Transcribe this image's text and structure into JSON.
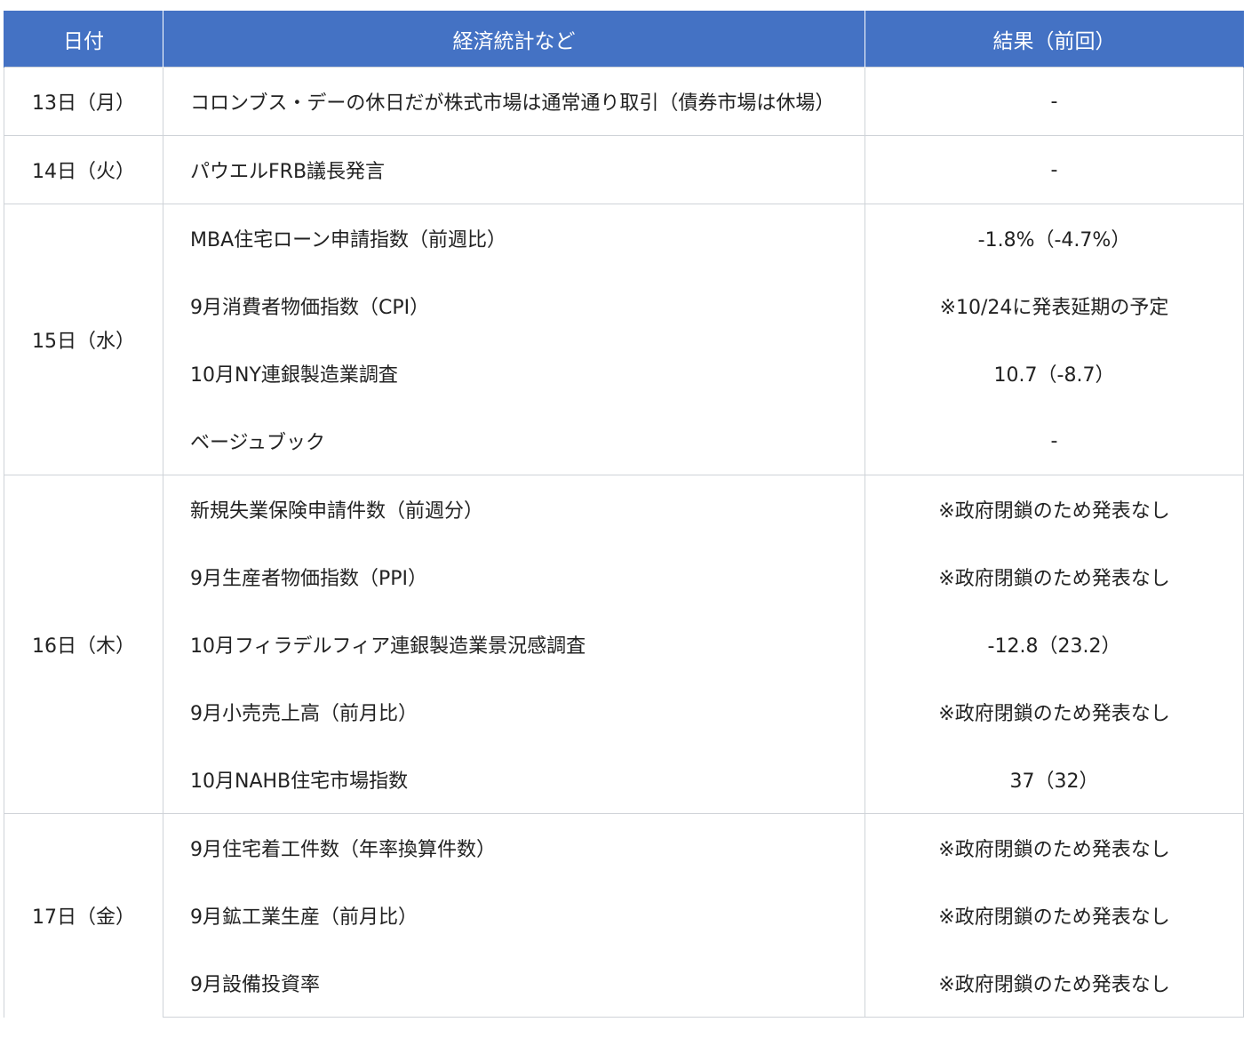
{
  "header": {
    "date": "日付",
    "event": "経済統計など",
    "result": "結果（前回）"
  },
  "rows": [
    {
      "date": "13日（月）",
      "event": "コロンブス・デーの休日だが株式市場は通常通り取引（債券市場は休場）",
      "result": "-"
    },
    {
      "date": "14日（火）",
      "event": "パウエルFRB議長発言",
      "result": "-"
    },
    {
      "date": "15日（水）",
      "event": "MBA住宅ローン申請指数（前週比）",
      "result": "-1.8%（-4.7%）"
    },
    {
      "date": "",
      "event": "9月消費者物価指数（CPI）",
      "result": "※10/24に発表延期の予定"
    },
    {
      "date": "",
      "event": "10月NY連銀製造業調査",
      "result": "10.7（-8.7）"
    },
    {
      "date": "",
      "event": "ベージュブック",
      "result": "-"
    },
    {
      "date": "16日（木）",
      "event": "新規失業保険申請件数（前週分）",
      "result": "※政府閉鎖のため発表なし"
    },
    {
      "date": "",
      "event": "9月生産者物価指数（PPI）",
      "result": "※政府閉鎖のため発表なし"
    },
    {
      "date": "",
      "event": "10月フィラデルフィア連銀製造業景況感調査",
      "result": "-12.8（23.2）"
    },
    {
      "date": "",
      "event": "9月小売売上高（前月比）",
      "result": "※政府閉鎖のため発表なし"
    },
    {
      "date": "",
      "event": "10月NAHB住宅市場指数",
      "result": "37（32）"
    },
    {
      "date": "17日（金）",
      "event": "9月住宅着工件数（年率換算件数）",
      "result": "※政府閉鎖のため発表なし"
    },
    {
      "date": "",
      "event": "9月鉱工業生産（前月比）",
      "result": "※政府閉鎖のため発表なし"
    },
    {
      "date": "",
      "event": "9月設備投資率",
      "result": "※政府閉鎖のため発表なし"
    }
  ]
}
